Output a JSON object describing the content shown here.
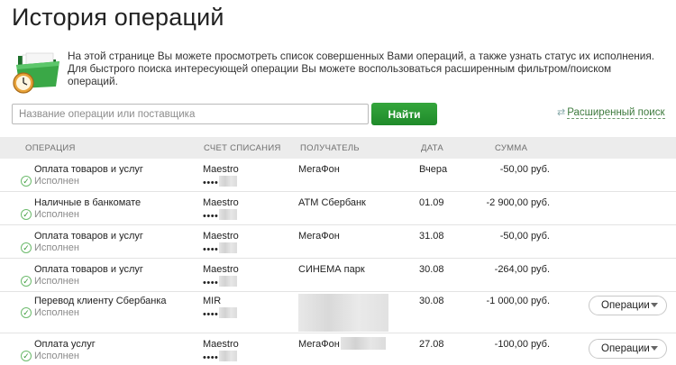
{
  "page": {
    "title": "История операций",
    "intro": "На этой странице Вы можете просмотреть список совершенных Вами операций, а также узнать статус их исполнения. Для быстрого поиска интересующей операции Вы можете воспользоваться расширенным фильтром/поиском операций."
  },
  "search": {
    "placeholder": "Название операции или поставщика",
    "value": "",
    "button_label": "Найти",
    "advanced_label": "Расширенный поиск"
  },
  "table": {
    "columns": {
      "operation": "Операция",
      "account": "Счет списания",
      "recipient": "Получатель",
      "date": "Дата",
      "amount": "Сумма"
    },
    "rows": [
      {
        "name": "Оплата товаров и услуг",
        "status": "Исполнен",
        "account": "Maestro",
        "masked": "••••",
        "recipient": "МегаФон",
        "date": "Вчера",
        "amount": "-50,00 руб."
      },
      {
        "name": "Наличные в банкомате",
        "status": "Исполнен",
        "account": "Maestro",
        "masked": "••••",
        "recipient": "ATM Сбербанк",
        "date": "01.09",
        "amount": "-2 900,00 руб."
      },
      {
        "name": "Оплата товаров и услуг",
        "status": "Исполнен",
        "account": "Maestro",
        "masked": "••••",
        "recipient": "МегаФон",
        "date": "31.08",
        "amount": "-50,00 руб."
      },
      {
        "name": "Оплата товаров и услуг",
        "status": "Исполнен",
        "account": "Maestro",
        "masked": "••••",
        "recipient": "СИНЕМА парк",
        "date": "30.08",
        "amount": "-264,00 руб."
      },
      {
        "name": "Перевод клиенту Сбербанка",
        "status": "Исполнен",
        "account": "MIR",
        "masked": "••••",
        "recipient": "",
        "date": "30.08",
        "amount": "-1 000,00 руб.",
        "action": "Операции"
      },
      {
        "name": "Оплата услуг",
        "status": "Исполнен",
        "account": "Maestro",
        "masked": "••••",
        "recipient": "МегаФон",
        "date": "27.08",
        "amount": "-100,00 руб.",
        "action": "Операции"
      }
    ]
  },
  "icons": {
    "folder": "folder-clock-icon",
    "status": "check-circle-icon",
    "advanced": "swap-arrows-icon",
    "dropdown": "chevron-down-icon"
  },
  "colors": {
    "accent_green": "#1f8a2a",
    "link_green": "#3d7a3d",
    "header_bg": "#ececec"
  }
}
